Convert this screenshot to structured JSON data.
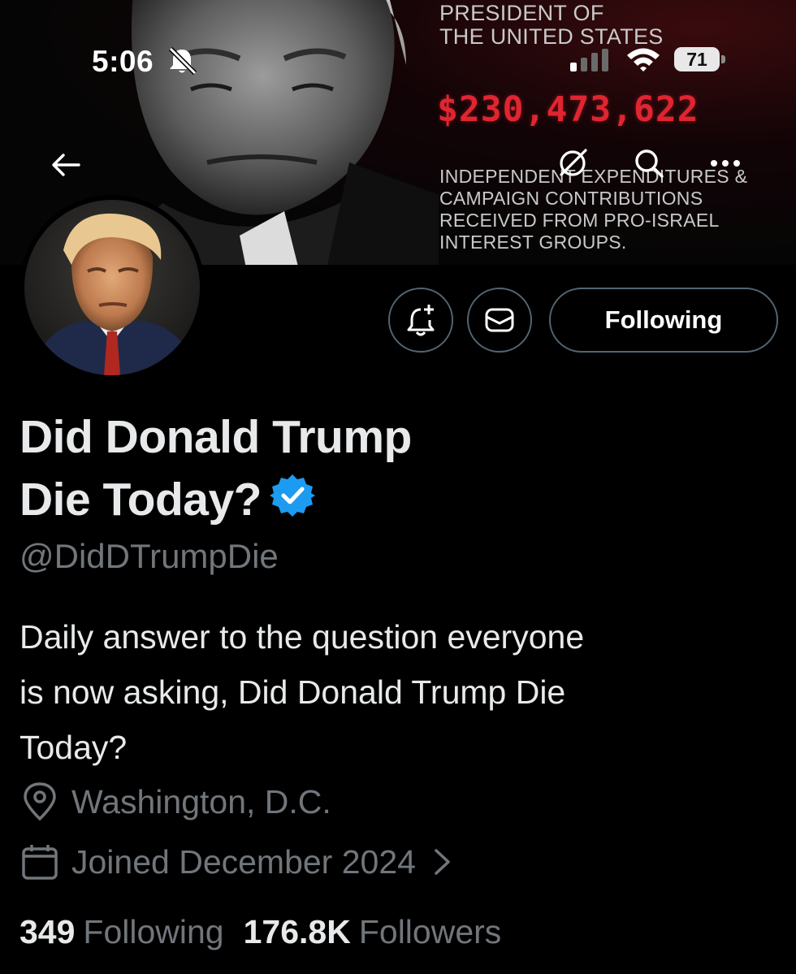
{
  "status_bar": {
    "time": "5:06",
    "battery": "71"
  },
  "banner": {
    "title_lines": [
      "PRESIDENT OF",
      "THE UNITED STATES"
    ],
    "amount": "$230,473,622",
    "description_lines": [
      "INDEPENDENT EXPENDITURES &",
      "CAMPAIGN CONTRIBUTIONS",
      "RECEIVED FROM PRO-ISRAEL",
      "INTEREST GROUPS."
    ],
    "amount_color": "#e02531"
  },
  "actions": {
    "follow_label": "Following"
  },
  "profile": {
    "name_lines": [
      "Did Donald Trump",
      "Die Today?"
    ],
    "handle": "@DidDTrumpDie",
    "bio_lines": [
      "Daily answer to the question everyone",
      "is now asking, Did Donald Trump Die",
      "Today?"
    ],
    "location": "Washington, D.C.",
    "joined": "Joined December 2024",
    "verified_color": "#1d9bf0"
  },
  "stats": {
    "following_count": "349",
    "following_label": "Following",
    "followers_count": "176.8K",
    "followers_label": "Followers"
  },
  "icons": [
    "back-arrow-icon",
    "grok-icon",
    "search-icon",
    "more-icon",
    "notification-add-icon",
    "message-icon",
    "verified-icon",
    "location-pin-icon",
    "calendar-icon",
    "chevron-right-icon"
  ]
}
